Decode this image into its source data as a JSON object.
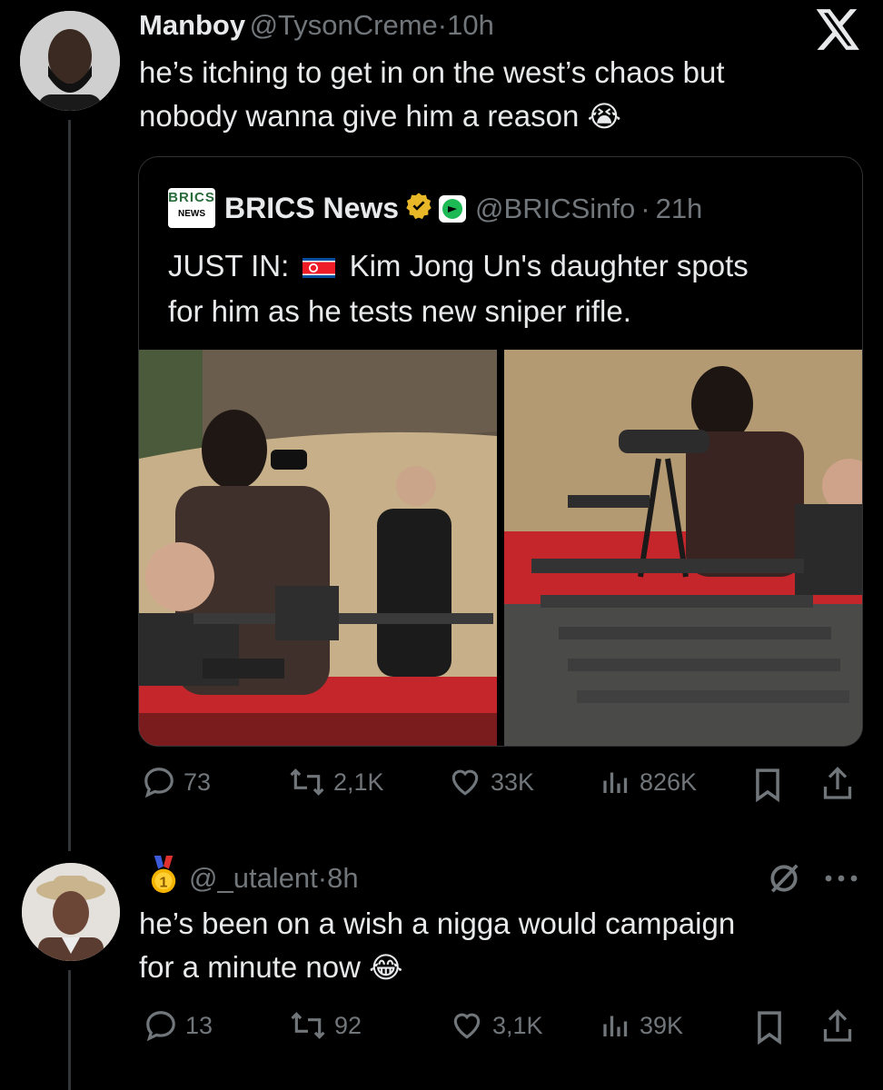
{
  "x_logo": "X",
  "tweet": {
    "avatar_icon": "bearded-man-avatar",
    "name": "Manboy",
    "handle": "@TysonCreme",
    "dot": "·",
    "time": "10h",
    "text": "he’s itching to get in on the west’s chaos but nobody wanna give him a reason",
    "emoji": "😭",
    "quote": {
      "logo_top": "BRICS",
      "logo_bottom": "NEWS",
      "name": "BRICS News",
      "handle": "@BRICSinfo",
      "dot": "·",
      "time": "21h",
      "text_prefix": "JUST IN:",
      "flag": "north-korea-flag",
      "text_line1_rest": "Kim Jong Un's daughter spots",
      "text_line2": "for him as he tests new sniper rifle."
    },
    "stats": {
      "replies": "73",
      "reposts": "2,1K",
      "likes": "33K",
      "views": "826K"
    }
  },
  "reply": {
    "badge_icon": "gold-medal-badge-icon",
    "handle": "@_utalent",
    "dot": "·",
    "time": "8h",
    "text_line1": "he’s been on a wish a nigga would campaign",
    "text_line2": "for a minute now",
    "emoji": "😂",
    "stats": {
      "replies": "13",
      "reposts": "92",
      "likes": "3,1K",
      "views": "39K"
    }
  },
  "colors": {
    "background": "#000000",
    "text": "#e7e9ea",
    "muted": "#71767b",
    "border": "#2f3336",
    "verified_gold": "#e8b829"
  }
}
